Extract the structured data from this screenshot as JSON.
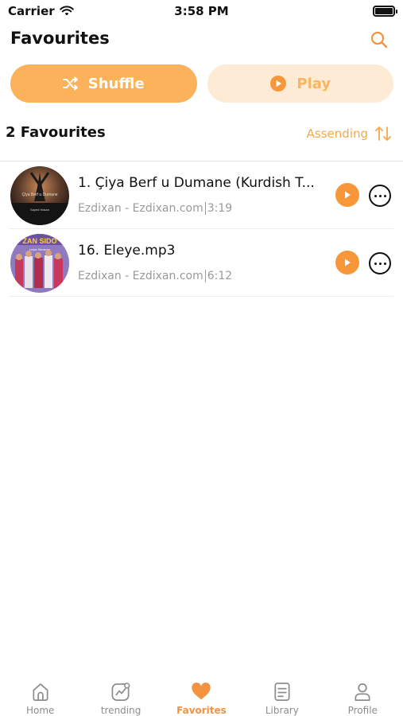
{
  "status_bar": {
    "carrier": "Carrier",
    "time": "3:58 PM"
  },
  "header": {
    "title": "Favourites"
  },
  "actions": {
    "shuffle_label": "Shuffle",
    "play_label": "Play"
  },
  "list_header": {
    "count_label": "2 Favourites",
    "sort_label": "Assending"
  },
  "songs": [
    {
      "title": "1. Çiya Berf u Dumane (Kurdish T...",
      "artist": "Ezdixan - Ezdixan.com",
      "duration": "3:19"
    },
    {
      "title": "16. Eleye.mp3",
      "artist": "Ezdixan - Ezdixan.com",
      "duration": "6:12"
    }
  ],
  "cover_texts": {
    "song1": [
      "Çiya Berf u Dumane",
      "Sayed Hasan"
    ],
    "song2": [
      "ZAN SIDO",
      "Leyla Simanan"
    ]
  },
  "tabs": [
    {
      "label": "Home",
      "icon": "home-icon"
    },
    {
      "label": "trending",
      "icon": "trending-icon"
    },
    {
      "label": "Favorites",
      "icon": "heart-icon",
      "active": true
    },
    {
      "label": "Library",
      "icon": "library-icon"
    },
    {
      "label": "Profile",
      "icon": "profile-icon"
    }
  ],
  "colors": {
    "accent": "#f7973a",
    "shuffle_bg": "#fbb25a",
    "play_bg": "#fdebd6",
    "play_text": "#f9b561",
    "sort_text": "#f6a84a",
    "meta_text": "#9a9a9a",
    "tab_inactive": "#8d8d8d"
  }
}
